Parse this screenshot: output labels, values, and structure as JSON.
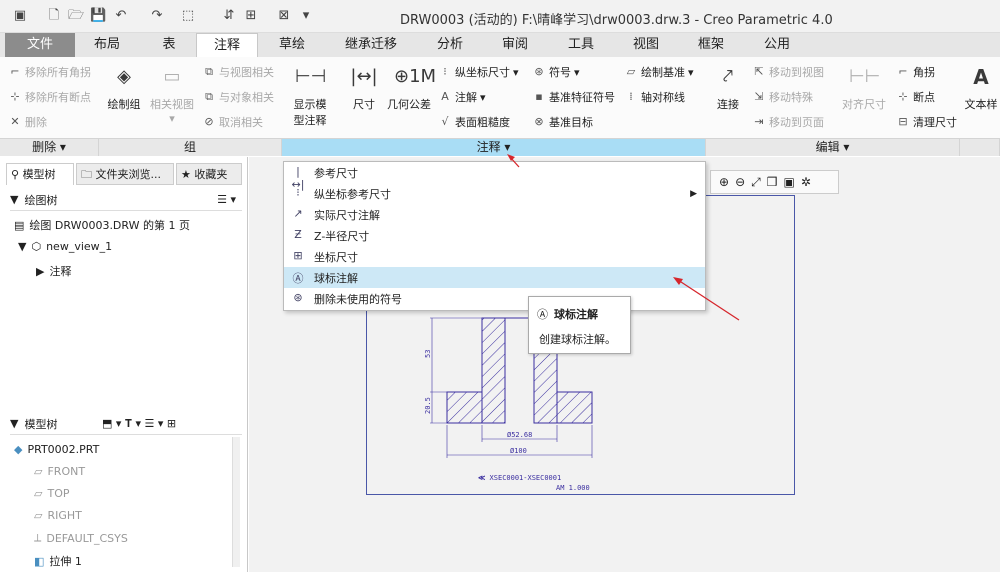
{
  "app": {
    "title": "DRW0003 (活动的) F:\\晴峰学习\\drw0003.drw.3 - Creo Parametric 4.0"
  },
  "tabs": [
    "文件",
    "布局",
    "表",
    "注释",
    "草绘",
    "继承迁移",
    "分析",
    "审阅",
    "工具",
    "视图",
    "框架",
    "公用"
  ],
  "ribbon": {
    "delete_group": {
      "label": "删除",
      "remove_all_angle": "移除所有角拐",
      "remove_all_break": "移除所有断点",
      "delete": "删除"
    },
    "group_group": {
      "label": "组",
      "draw_group": "绘制组",
      "related_view": "相关视图",
      "view_related": "与视图相关",
      "object_related": "与对象相关",
      "unrelate": "取消相关"
    },
    "annot_group": {
      "label": "注释",
      "show_model_annot": "显示模型注释",
      "dimension": "尺寸",
      "geo_tol": "几何公差",
      "ordinate_dim": "纵坐标尺寸",
      "annotation": "注解",
      "surface_finish": "表面粗糙度",
      "symbol": "符号",
      "datum_feature_symbol": "基准特征符号",
      "datum_target": "基准目标",
      "draw_datum": "绘制基准",
      "axis_symmetry": "轴对称线"
    },
    "edit_group": {
      "label": "编辑",
      "connect": "连接",
      "move_to_view": "移动到视图",
      "move_special": "移动特殊",
      "move_to_page": "移动到页面",
      "align_dim": "对齐尺寸",
      "corner": "角拐",
      "breakpoint": "断点",
      "clean_dim": "清理尺寸",
      "text_style": "文本样"
    }
  },
  "left_panel": {
    "tabs": [
      "模型树",
      "文件夹浏览...",
      "收藏夹"
    ],
    "drawing_tree_label": "绘图树",
    "drawing_items": [
      "绘图 DRW0003.DRW 的第 1 页",
      "new_view_1",
      "注释"
    ],
    "model_tree_label": "模型树",
    "model_items": [
      "PRT0002.PRT",
      "FRONT",
      "TOP",
      "RIGHT",
      "DEFAULT_CSYS",
      "拉伸 1"
    ]
  },
  "dropdown": {
    "items": [
      "参考尺寸",
      "纵坐标参考尺寸",
      "实际尺寸注解",
      "Z-半径尺寸",
      "坐标尺寸",
      "球标注解",
      "删除未使用的符号"
    ]
  },
  "tooltip": {
    "title": "球标注解",
    "desc": "创建球标注解。"
  },
  "drawing": {
    "dims": [
      "53",
      "20.5",
      "Ø52.68",
      "Ø100"
    ],
    "note_line1": "XSEC0001-XSEC0001",
    "note_line2": "AM  1.000",
    "note_prefix": "≪"
  },
  "colors": {
    "accent": "#a9ddf5",
    "annotation_red": "#d6262c",
    "drawing_line": "#3b2fa0",
    "sheet_border": "#4a57a8"
  }
}
